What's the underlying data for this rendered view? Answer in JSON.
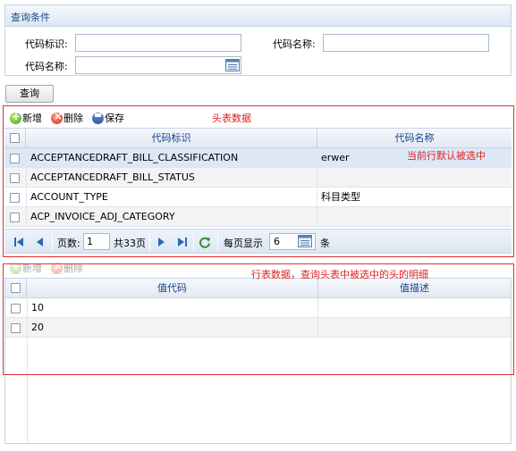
{
  "query_panel": {
    "title": "查询条件",
    "field1_label": "代码标识:",
    "field1_value": "",
    "field2_label": "代码名称:",
    "field2_value": "",
    "field3_label": "代码名称:",
    "field3_value": "",
    "query_button": "查询"
  },
  "header_grid": {
    "toolbar": {
      "add": "新增",
      "delete": "删除",
      "save": "保存"
    },
    "columns": [
      "代码标识",
      "代码名称"
    ],
    "rows": [
      {
        "code": "ACCEPTANCEDRAFT_BILL_CLASSIFICATION",
        "name": "erwer"
      },
      {
        "code": "ACCEPTANCEDRAFT_BILL_STATUS",
        "name": ""
      },
      {
        "code": "ACCOUNT_TYPE",
        "name": "科目类型"
      },
      {
        "code": "ACP_INVOICE_ADJ_CATEGORY",
        "name": ""
      }
    ],
    "pager": {
      "page_label": "页数:",
      "page_value": "1",
      "total_pages": "共33页",
      "per_page_label": "每页显示",
      "per_page_value": "6",
      "per_page_unit": "条"
    }
  },
  "detail_grid": {
    "toolbar": {
      "add": "新增",
      "delete": "删除"
    },
    "columns": [
      "值代码",
      "值描述"
    ],
    "rows": [
      {
        "value_code": "10",
        "value_desc": ""
      },
      {
        "value_code": "20",
        "value_desc": ""
      }
    ]
  },
  "annotations": {
    "header_data": "头表数据",
    "current_row_selected": "当前行默认被选中",
    "line_data": "行表数据，查询头表中被选中的头的明细"
  },
  "colors": {
    "annotation_red": "#e02020",
    "header_text": "#15428b",
    "panel_border": "#c5d3e6"
  }
}
